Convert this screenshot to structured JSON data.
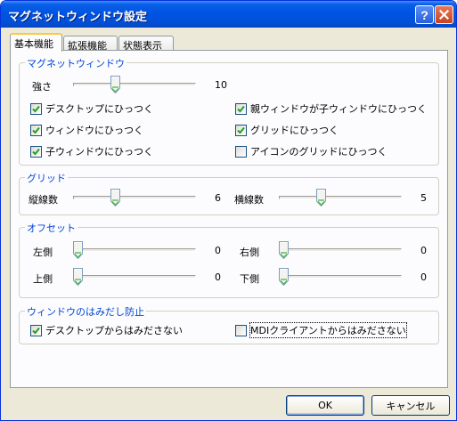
{
  "window": {
    "title": "マグネットウィンドウ設定",
    "help_glyph": "?"
  },
  "tabs": [
    "基本機能",
    "拡張機能",
    "状態表示"
  ],
  "magnet": {
    "group_title": "マグネットウィンドウ",
    "strength_label": "強さ",
    "strength_value": "10",
    "strength_level": 0.33,
    "checkboxes": [
      {
        "label": "デスクトップにひっつく",
        "checked": true
      },
      {
        "label": "親ウィンドウが子ウィンドウにひっつく",
        "checked": true
      },
      {
        "label": "ウィンドウにひっつく",
        "checked": true
      },
      {
        "label": "グリッドにひっつく",
        "checked": true
      },
      {
        "label": "子ウィンドウにひっつく",
        "checked": true
      },
      {
        "label": "アイコンのグリッドにひっつく",
        "checked": false
      }
    ]
  },
  "grid": {
    "group_title": "グリッド",
    "vertical_label": "縦線数",
    "vertical_value": "6",
    "vertical_level": 0.33,
    "horizontal_label": "横線数",
    "horizontal_value": "5",
    "horizontal_level": 0.33
  },
  "offset": {
    "group_title": "オフセット",
    "left_label": "左側",
    "left_value": "0",
    "left_level": 0,
    "right_label": "右側",
    "right_value": "0",
    "right_level": 0,
    "top_label": "上側",
    "top_value": "0",
    "top_level": 0,
    "bottom_label": "下側",
    "bottom_value": "0",
    "bottom_level": 0
  },
  "overflow": {
    "group_title": "ウィンドウのはみだし防止",
    "checkboxes": [
      {
        "label": "デスクトップからはみださない",
        "checked": true
      },
      {
        "label": "MDIクライアントからはみださない",
        "checked": false
      }
    ]
  },
  "buttons": {
    "ok": "OK",
    "cancel": "キャンセル"
  }
}
